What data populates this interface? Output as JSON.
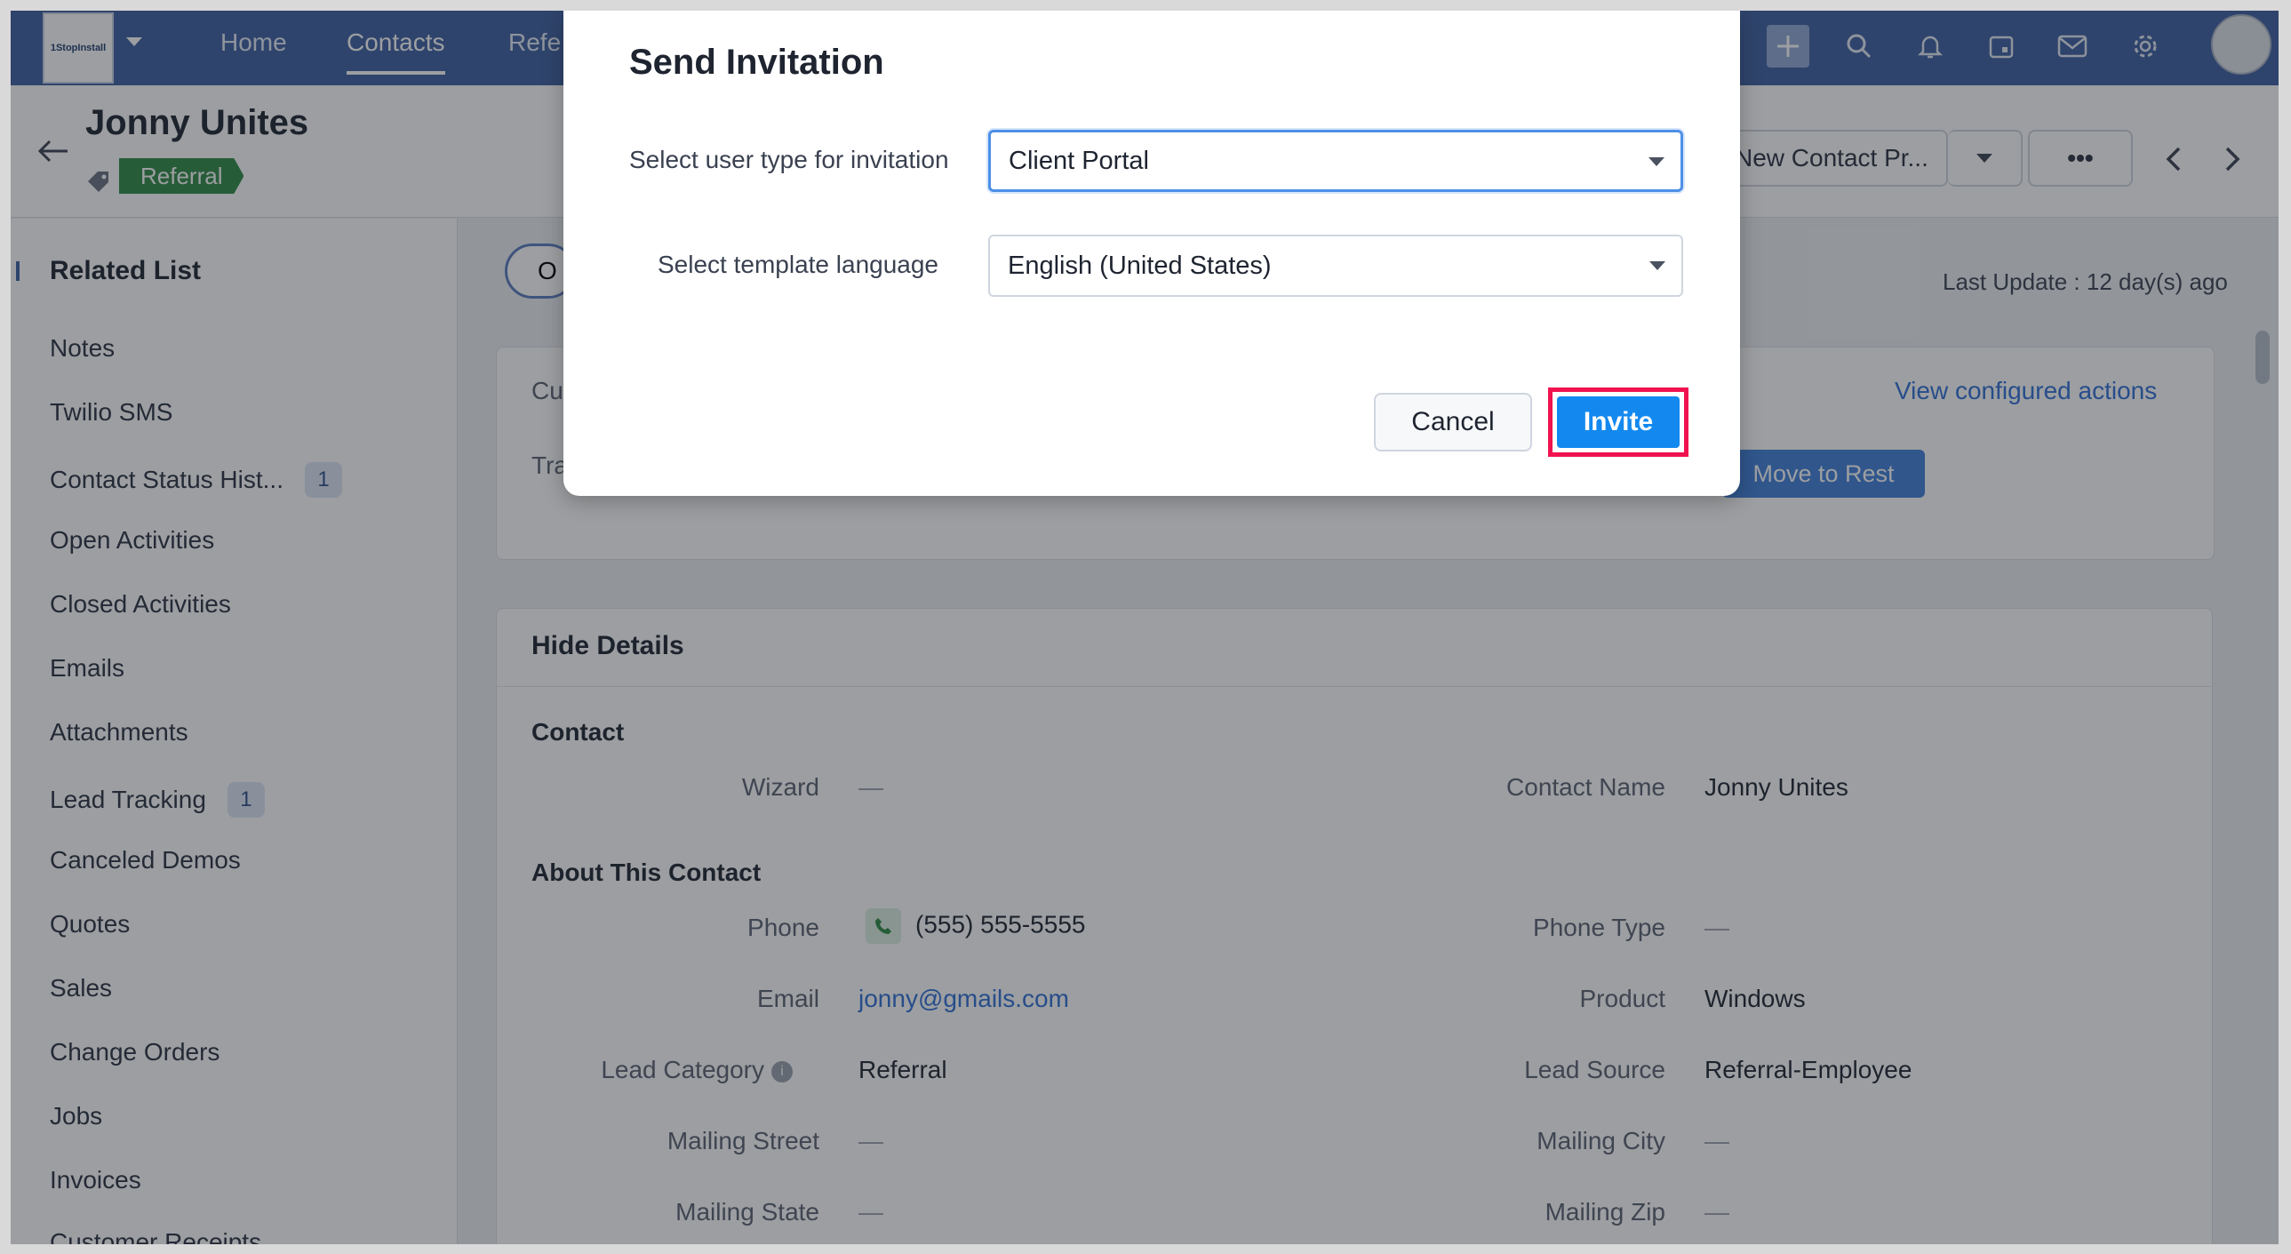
{
  "topbar": {
    "logo_text": "1StopInstall",
    "nav": [
      "Home",
      "Contacts",
      "Refe"
    ],
    "icons": [
      "add-icon",
      "search-icon",
      "bell-icon",
      "calendar-icon",
      "mail-icon",
      "gear-icon",
      "avatar"
    ]
  },
  "record": {
    "name": "Jonny Unites",
    "tag": "Referral",
    "blueprint_button": "New Contact Pr...",
    "more_button": "•••"
  },
  "sidebar": {
    "title": "Related List",
    "items": [
      {
        "label": "Notes",
        "count": ""
      },
      {
        "label": "Twilio SMS",
        "count": ""
      },
      {
        "label": "Contact Status Hist...",
        "count": "1"
      },
      {
        "label": "Open Activities",
        "count": ""
      },
      {
        "label": "Closed Activities",
        "count": ""
      },
      {
        "label": "Emails",
        "count": ""
      },
      {
        "label": "Attachments",
        "count": ""
      },
      {
        "label": "Lead Tracking",
        "count": "1"
      },
      {
        "label": "Canceled Demos",
        "count": ""
      },
      {
        "label": "Quotes",
        "count": ""
      },
      {
        "label": "Sales",
        "count": ""
      },
      {
        "label": "Change Orders",
        "count": ""
      },
      {
        "label": "Jobs",
        "count": ""
      },
      {
        "label": "Invoices",
        "count": ""
      },
      {
        "label": "Customer Receipts",
        "count": ""
      }
    ]
  },
  "main": {
    "tab_fragment": "O",
    "last_update": "Last Update : 12 day(s) ago",
    "cu_fragment": "Cu",
    "tra_fragment": "Tra",
    "view_actions": "View configured actions",
    "move_button": "Move to Rest"
  },
  "details": {
    "header": "Hide Details",
    "section_contact": "Contact",
    "section_about": "About This Contact",
    "fields": {
      "wizard_label": "Wizard",
      "wizard_value": "—",
      "contact_name_label": "Contact Name",
      "contact_name_value": "Jonny Unites",
      "phone_label": "Phone",
      "phone_value": "(555) 555-5555",
      "phone_type_label": "Phone Type",
      "phone_type_value": "—",
      "email_label": "Email",
      "email_value": "jonny@gmails.com",
      "product_label": "Product",
      "product_value": "Windows",
      "lead_category_label": "Lead Category",
      "lead_category_value": "Referral",
      "lead_source_label": "Lead Source",
      "lead_source_value": "Referral-Employee",
      "mailing_street_label": "Mailing Street",
      "mailing_street_value": "—",
      "mailing_city_label": "Mailing City",
      "mailing_city_value": "—",
      "mailing_state_label": "Mailing State",
      "mailing_state_value": "—",
      "mailing_zip_label": "Mailing Zip",
      "mailing_zip_value": "—"
    }
  },
  "modal": {
    "title": "Send Invitation",
    "user_type_label": "Select user type for invitation",
    "user_type_value": "Client Portal",
    "language_label": "Select template language",
    "language_value": "English (United States)",
    "cancel_label": "Cancel",
    "invite_label": "Invite"
  },
  "colors": {
    "topbar": "#3d5fa0",
    "accent": "#1389f0",
    "highlight": "#f0134f",
    "tag": "#2f8a45"
  }
}
